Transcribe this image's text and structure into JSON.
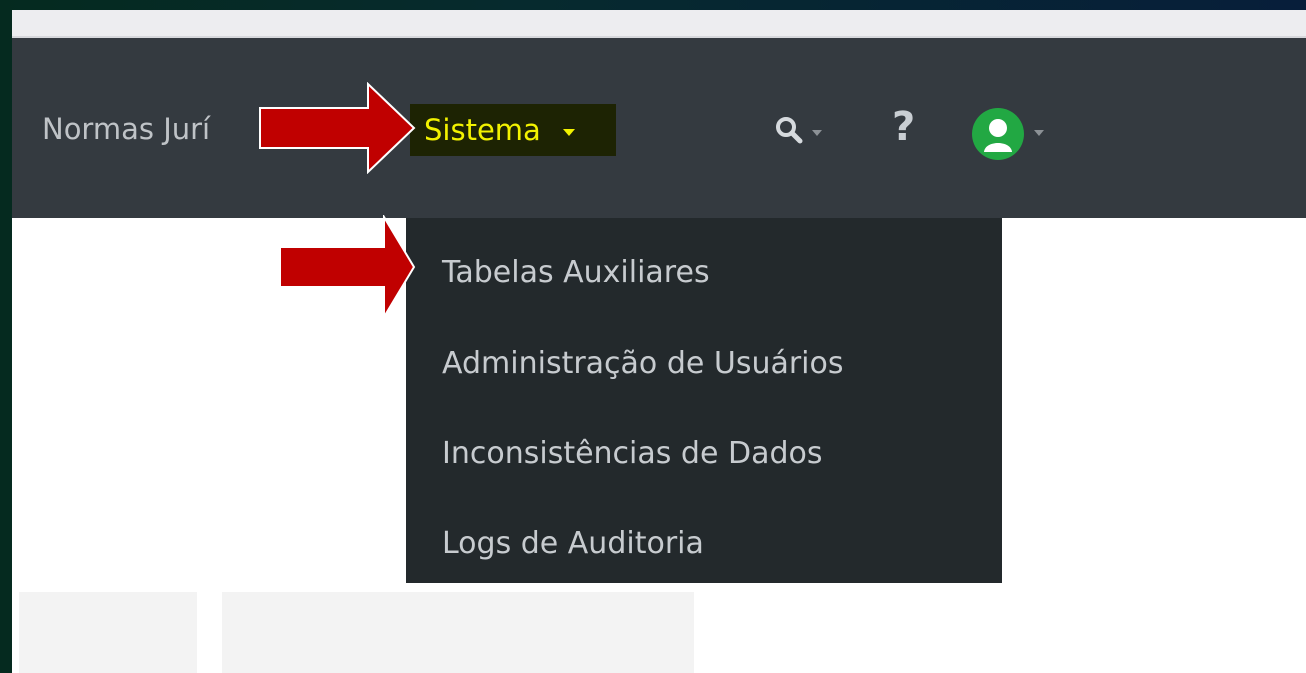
{
  "navbar": {
    "brand_partial": "Normas Jurí",
    "menu_sistema": "Sistema",
    "help_label": "?",
    "icons": [
      "search-icon",
      "help-icon",
      "user-avatar-icon",
      "chevron-down-icon"
    ]
  },
  "dropdown": {
    "items": [
      "Tabelas Auxiliares",
      "Administração de Usuários",
      "Inconsistências de Dados",
      "Logs de Auditoria"
    ]
  },
  "annotations": {
    "arrow_color": "#c00000",
    "highlight_color": "#f2f200"
  }
}
